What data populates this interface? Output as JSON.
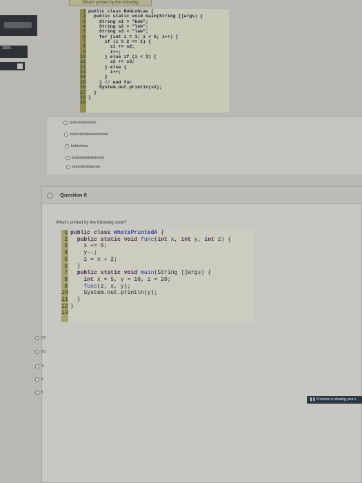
{
  "top_tab": {
    "label": "What's printed by the following"
  },
  "left_panel": {
    "zoom_label": "100%"
  },
  "code_block_1": {
    "line_numbers": [
      "1",
      "2",
      "3",
      "4",
      "5",
      "6",
      "7",
      "8",
      "9",
      "10",
      "11",
      "12",
      "13",
      "14",
      "15",
      "16",
      "17",
      "18",
      "19"
    ],
    "lines": [
      "public class BobLobLaw {",
      "  public static void main(String []args) {",
      "    String s1 = \"bob\";",
      "    String s2 = \"lob\";",
      "    String s3 = \"law\";",
      "",
      "    for (int i = 1; i < 6; i++) {",
      "      if (i % 2 == 1) {",
      "        s1 += s2;",
      "        i++;",
      "      } else if (i < 3) {",
      "        s2 += s3;",
      "      } else {",
      "        i++;",
      "      }",
      "    } // end for",
      "    System.out.println(s1);",
      "  }",
      "}"
    ]
  },
  "question_7_options": [
    "bobloblobloblob",
    "boblobloblawlobloblaw",
    "bobloblaw",
    "bobloblobloblawlob",
    "boblobloblawlaw"
  ],
  "question_8": {
    "title": "Question 8",
    "prompt": "What's printed by the following code?",
    "code": {
      "line_numbers": [
        "1",
        "2",
        "3",
        "4",
        "5",
        "6",
        "7",
        "8",
        "9",
        "10",
        "11",
        "12",
        "13"
      ],
      "lines": [
        "public class WhatsPrintedA {",
        "  public static void func(int x, int y, int z) {",
        "    x += 5;",
        "    y--;",
        "    z = x + 2;",
        "  }",
        "",
        "  public static void main(String []args) {",
        "    int x = 5, y = 10, z = 20;",
        "    func(z, x, y);",
        "    System.out.println(y);",
        "  }",
        "}"
      ]
    },
    "options": [
      "27",
      "10",
      "4",
      "9",
      "5"
    ]
  },
  "proctorio_banner": {
    "text": "Proctorio is sharing your s"
  }
}
